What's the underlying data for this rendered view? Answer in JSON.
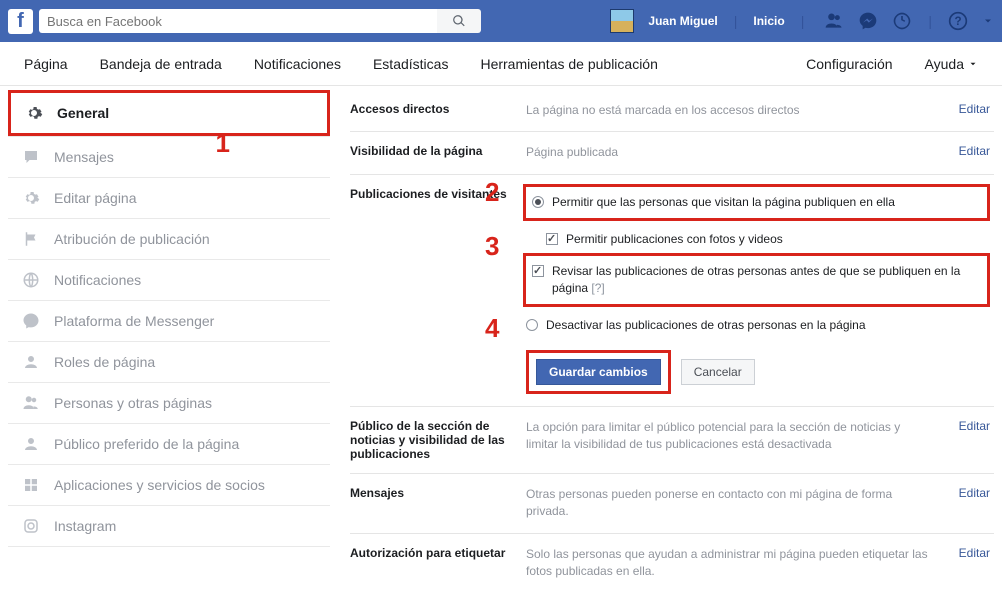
{
  "navbar": {
    "search_placeholder": "Busca en Facebook",
    "user_name": "Juan Miguel",
    "home_label": "Inicio"
  },
  "pagenav": {
    "items": [
      "Página",
      "Bandeja de entrada",
      "Notificaciones",
      "Estadísticas",
      "Herramientas de publicación"
    ],
    "right": {
      "config": "Configuración",
      "help": "Ayuda"
    }
  },
  "sidebar": {
    "items": [
      {
        "label": "General",
        "icon": "gear-icon"
      },
      {
        "label": "Mensajes",
        "icon": "speech-icon"
      },
      {
        "label": "Editar página",
        "icon": "gear-icon"
      },
      {
        "label": "Atribución de publicación",
        "icon": "flag-icon"
      },
      {
        "label": "Notificaciones",
        "icon": "globe-icon"
      },
      {
        "label": "Plataforma de Messenger",
        "icon": "messenger-icon"
      },
      {
        "label": "Roles de página",
        "icon": "person-icon"
      },
      {
        "label": "Personas y otras páginas",
        "icon": "people-icon"
      },
      {
        "label": "Público preferido de la página",
        "icon": "person-icon"
      },
      {
        "label": "Aplicaciones y servicios de socios",
        "icon": "apps-icon"
      },
      {
        "label": "Instagram",
        "icon": "instagram-icon"
      }
    ]
  },
  "settings": {
    "edit_label": "Editar",
    "rows": {
      "shortcuts": {
        "label": "Accesos directos",
        "value": "La página no está marcada en los accesos directos"
      },
      "visibility": {
        "label": "Visibilidad de la página",
        "value": "Página publicada"
      },
      "visitors": {
        "label": "Publicaciones de visitantes",
        "opt_allow": "Permitir que las personas que visitan la página publiquen en ella",
        "opt_media": "Permitir publicaciones con fotos y videos",
        "opt_review": "Revisar las publicaciones de otras personas antes de que se publiquen en la página",
        "opt_disable": "Desactivar las publicaciones de otras personas en la página",
        "save": "Guardar cambios",
        "cancel": "Cancelar"
      },
      "audience": {
        "label": "Público de la sección de noticias y visibilidad de las publicaciones",
        "value": "La opción para limitar el público potencial para la sección de noticias y limitar la visibilidad de tus publicaciones está desactivada"
      },
      "messages": {
        "label": "Mensajes",
        "value": "Otras personas pueden ponerse en contacto con mi página de forma privada."
      },
      "tagging": {
        "label": "Autorización para etiquetar",
        "value": "Solo las personas que ayudan a administrar mi página pueden etiquetar las fotos publicadas en ella."
      }
    }
  },
  "annotations": {
    "n1": "1",
    "n2": "2",
    "n3": "3",
    "n4": "4"
  }
}
